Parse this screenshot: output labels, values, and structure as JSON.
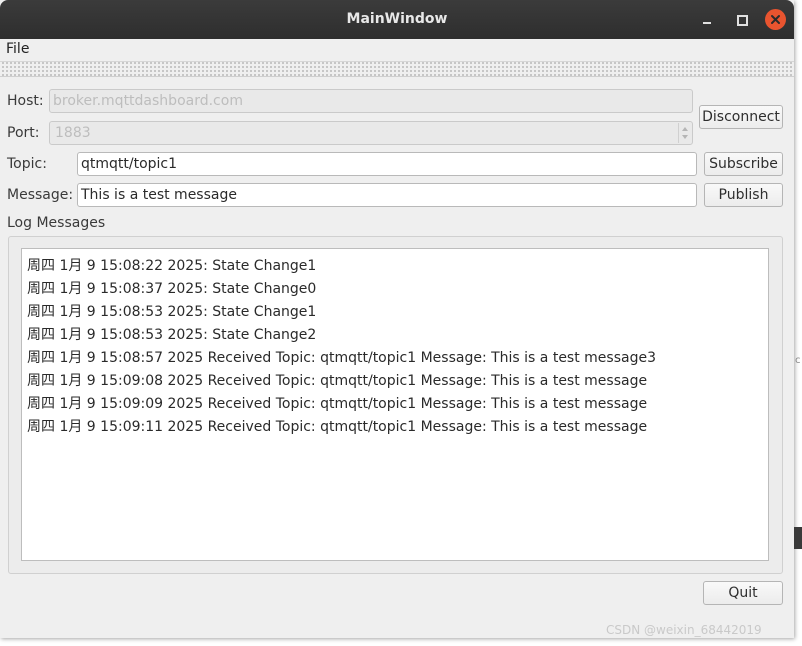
{
  "window": {
    "title": "MainWindow"
  },
  "menu": {
    "file": "File"
  },
  "form": {
    "host_label": "Host:",
    "host_value": "broker.mqttdashboard.com",
    "port_label": "Port:",
    "port_value": "1883",
    "topic_label": "Topic:",
    "topic_value": "qtmqtt/topic1",
    "message_label": "Message:",
    "message_value": "This is a test message"
  },
  "buttons": {
    "disconnect": "Disconnect",
    "subscribe": "Subscribe",
    "publish": "Publish",
    "quit": "Quit"
  },
  "log": {
    "title": "Log Messages",
    "lines": [
      "周四 1月 9 15:08:22 2025: State Change1",
      "周四 1月 9 15:08:37 2025: State Change0",
      "周四 1月 9 15:08:53 2025: State Change1",
      "周四 1月 9 15:08:53 2025: State Change2",
      "周四 1月 9 15:08:57 2025 Received Topic: qtmqtt/topic1 Message: This is a test message3",
      "周四 1月 9 15:09:08 2025 Received Topic: qtmqtt/topic1 Message: This is a test message",
      "周四 1月 9 15:09:09 2025 Received Topic: qtmqtt/topic1 Message: This is a test message",
      "周四 1月 9 15:09:11 2025 Received Topic: qtmqtt/topic1 Message: This is a test message"
    ]
  },
  "watermark": "CSDN @weixin_68442019",
  "colors": {
    "titlebar": "#2e2e2e",
    "close_button": "#e9542f",
    "window_bg": "#efefef"
  }
}
